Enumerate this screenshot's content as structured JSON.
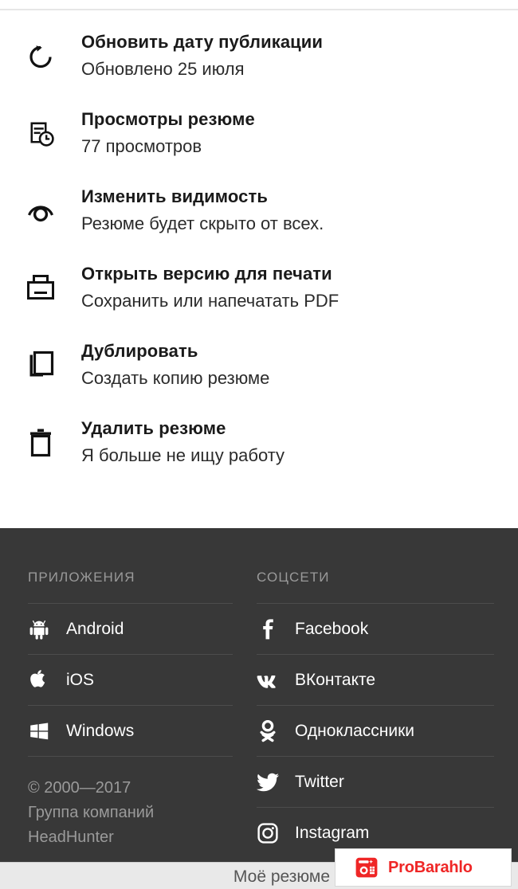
{
  "menu": {
    "items": [
      {
        "icon": "refresh-icon",
        "title": "Обновить дату публикации",
        "subtitle": "Обновлено 25 июля"
      },
      {
        "icon": "document-clock-icon",
        "title": "Просмотры резюме",
        "subtitle": "77 просмотров"
      },
      {
        "icon": "eye-icon",
        "title": "Изменить видимость",
        "subtitle": "Резюме будет скрыто от всех."
      },
      {
        "icon": "printer-icon",
        "title": "Открыть версию для печати",
        "subtitle": "Сохранить или напечатать PDF"
      },
      {
        "icon": "copy-icon",
        "title": "Дублировать",
        "subtitle": "Создать копию резюме"
      },
      {
        "icon": "trash-icon",
        "title": "Удалить резюме",
        "subtitle": "Я больше не ищу работу"
      }
    ]
  },
  "footer": {
    "apps": {
      "title": "ПРИЛОЖЕНИЯ",
      "links": [
        {
          "icon": "android-icon",
          "label": "Android"
        },
        {
          "icon": "apple-icon",
          "label": "iOS"
        },
        {
          "icon": "windows-icon",
          "label": "Windows"
        }
      ]
    },
    "social": {
      "title": "СОЦСЕТИ",
      "links": [
        {
          "icon": "facebook-icon",
          "label": "Facebook"
        },
        {
          "icon": "vk-icon",
          "label": "ВКонтакте"
        },
        {
          "icon": "odnoklassniki-icon",
          "label": "Одноклассники"
        },
        {
          "icon": "twitter-icon",
          "label": "Twitter"
        },
        {
          "icon": "instagram-icon",
          "label": "Instagram"
        }
      ]
    },
    "copyright": {
      "line1": "© 2000—2017",
      "line2": "Группа компаний",
      "line3": "HeadHunter"
    }
  },
  "bottom_bar": {
    "label": "Моё резюме"
  },
  "watermark": {
    "text": "ProBarahlo",
    "icon": "camera-icon",
    "color": "#ef2626"
  },
  "colors": {
    "page_bg": "#ffffff",
    "footer_bg": "#383838",
    "title_text": "#1a1a1a",
    "sub_text": "#2b2b2b",
    "footer_muted": "#9a9a9a",
    "bottom_bar_bg": "#e9e9e9"
  }
}
